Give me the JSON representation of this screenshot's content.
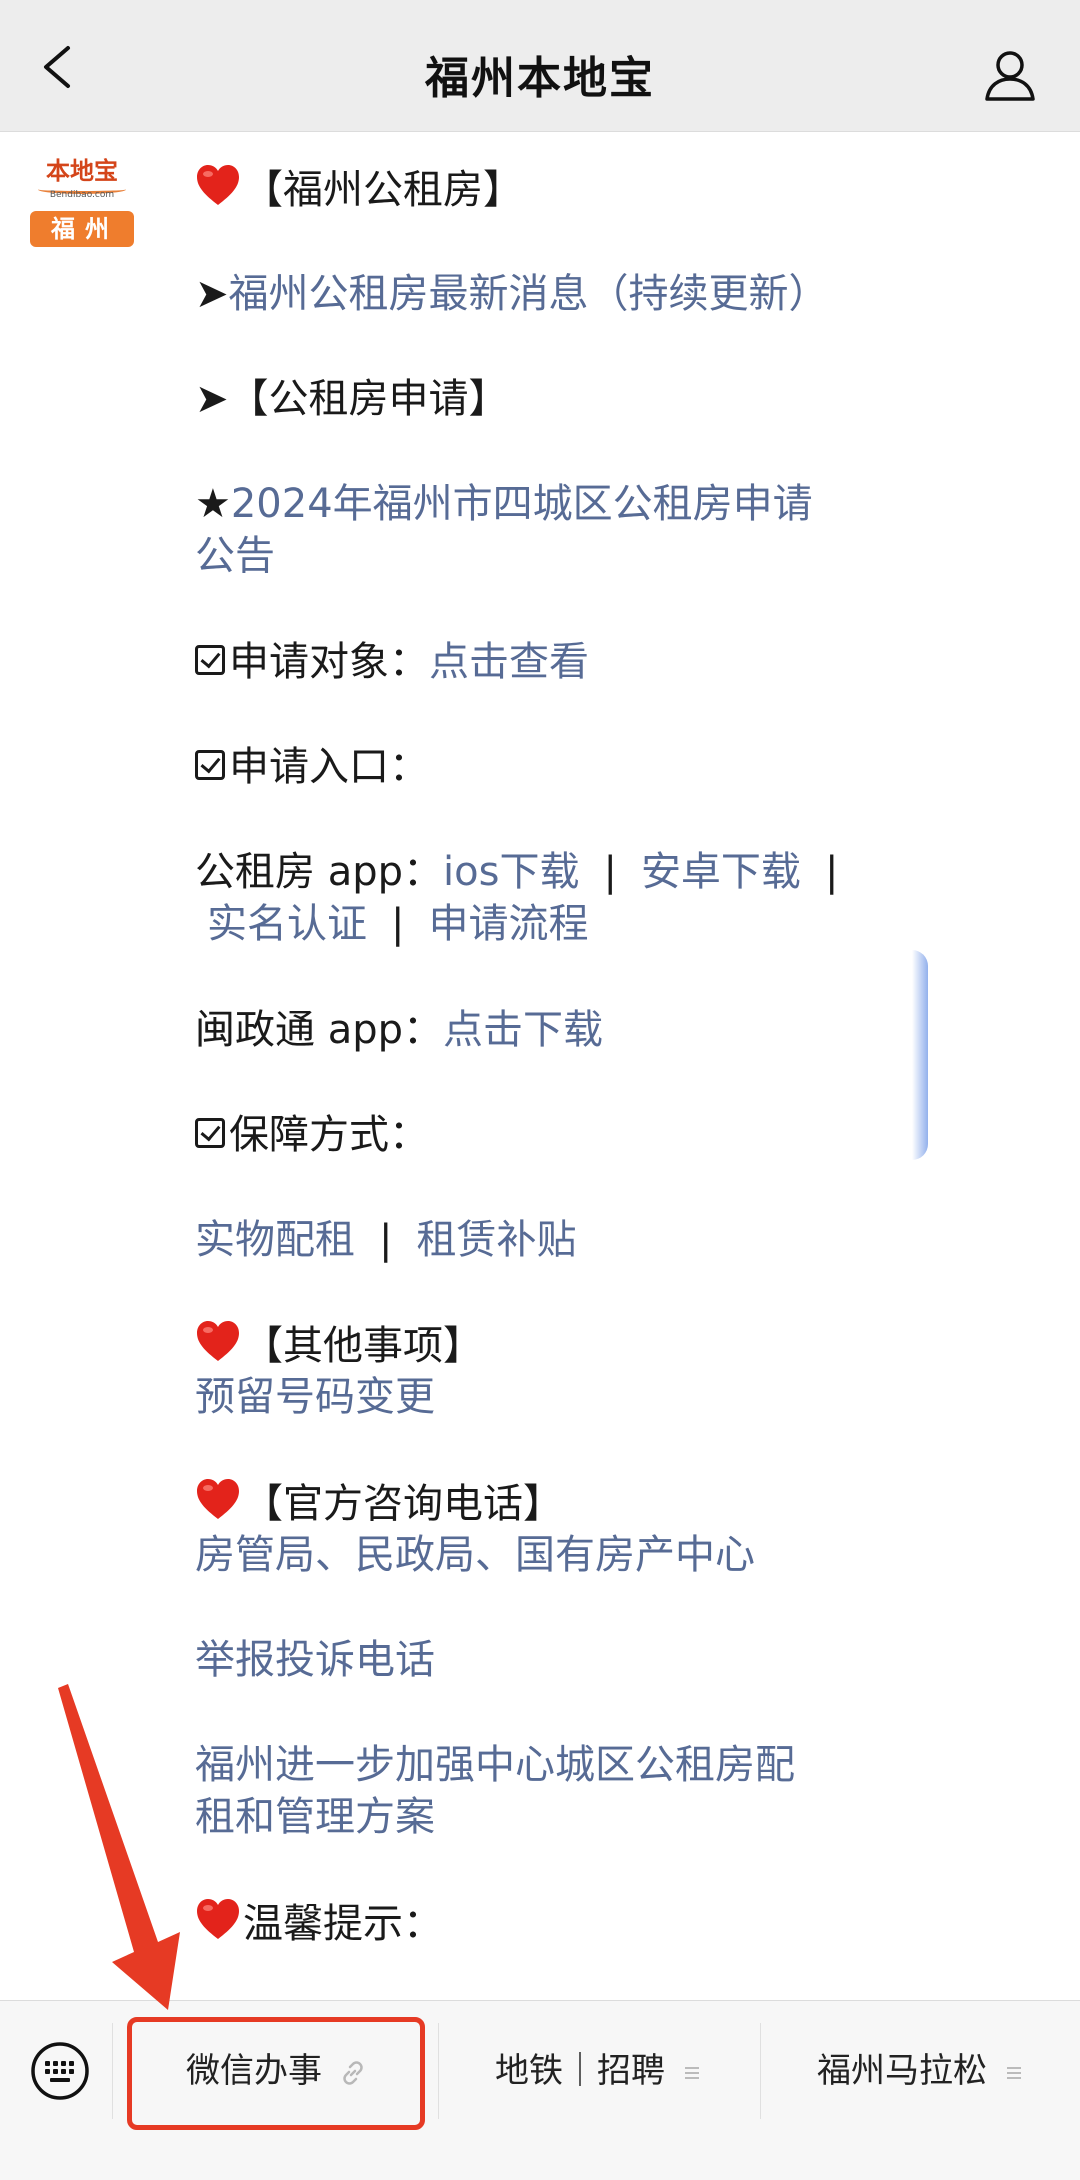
{
  "topbar": {
    "title": "福州本地宝"
  },
  "avatar": {
    "brand": "本地宝",
    "brand_sub": "Bendibao.com",
    "city": "福州"
  },
  "message": {
    "heading_rental": "【福州公租房】",
    "latest_news_prefix": "➤",
    "latest_news_link": "福州公租房最新消息（持续更新）",
    "apply_heading": "➤【公租房申请】",
    "notice_star": "★",
    "notice_link_line1": "2024年福州市四城区公租房申请",
    "notice_link_line2": "公告",
    "target_label": "申请对象：",
    "target_link": "点击查看",
    "entry_label": "申请入口：",
    "app_label": "公租房 app：",
    "app_links": [
      "ios下载",
      "安卓下载",
      "实名认证",
      "申请流程"
    ],
    "sep": "|",
    "mzt_label": "闽政通 app：",
    "mzt_link": "点击下载",
    "guarantee_label": "保障方式：",
    "guarantee_links": [
      "实物配租",
      "租赁补贴"
    ],
    "other_heading": "【其他事项】",
    "other_link": "预留号码变更",
    "phone_heading": "【官方咨询电话】",
    "phone_link": "房管局、民政局、国有房产中心",
    "report_link": "举报投诉电话",
    "plan_link_line1": "福州进一步加强中心城区公租房配",
    "plan_link_line2": "租和管理方案",
    "tip_heading": "温馨提示："
  },
  "bottom_menu": {
    "items": [
      {
        "label": "微信办事",
        "extra_icon": "link-icon"
      },
      {
        "label": "地铁｜招聘",
        "extra_icon": "menu-lines-icon"
      },
      {
        "label": "福州马拉松",
        "extra_icon": "menu-lines-icon"
      }
    ]
  },
  "colors": {
    "link": "#576b95",
    "annotation": "#e63a24",
    "topbar": "#ededed",
    "city_badge": "#ef7d2d"
  }
}
